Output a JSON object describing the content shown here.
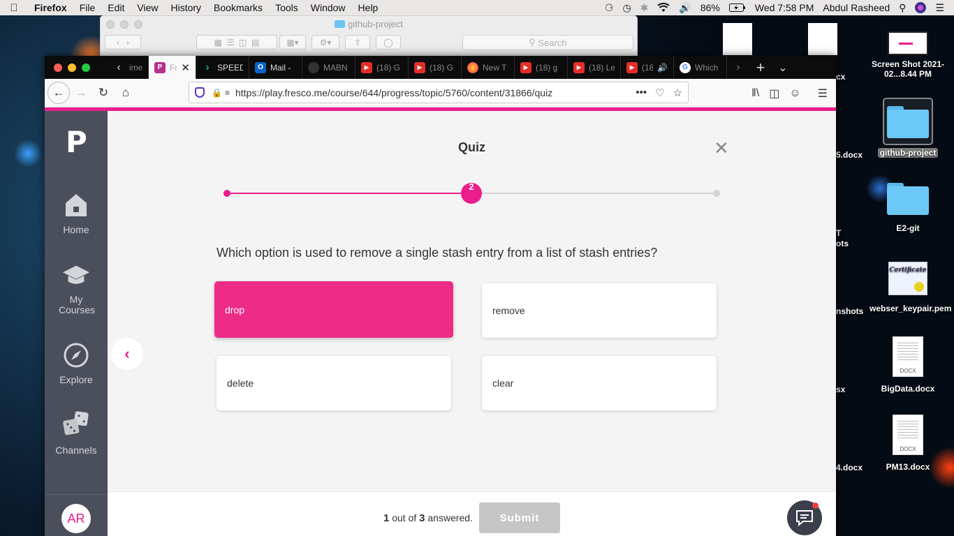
{
  "menubar": {
    "app": "Firefox",
    "items": [
      "File",
      "Edit",
      "View",
      "History",
      "Bookmarks",
      "Tools",
      "Window",
      "Help"
    ],
    "battery": "86%",
    "clock": "Wed 7:58 PM",
    "user": "Abdul Rasheed"
  },
  "finder": {
    "title": "github-project",
    "search_placeholder": "Search"
  },
  "desktop": {
    "items": [
      {
        "label": "Screen Shot 2021-02...8.44 PM",
        "icon": "screenshot-thumbnail"
      },
      {
        "label": "github-project",
        "icon": "folder-icon"
      },
      {
        "label": "E2-git",
        "icon": "folder-icon"
      },
      {
        "label": "webser_keypair.pem",
        "icon": "certificate-icon"
      },
      {
        "label": "BigData.docx",
        "icon": "docx-icon",
        "tag": "DOCX"
      },
      {
        "label": "PM13.docx",
        "icon": "docx-icon",
        "tag": "DOCX"
      }
    ],
    "partial_labels": [
      "cx",
      "5.docx",
      "T",
      "ots",
      "nshots",
      "sx",
      "4.docx"
    ]
  },
  "browser": {
    "tabs": [
      {
        "title": "ime",
        "icon": "page-icon",
        "color": "#555"
      },
      {
        "title": "Fre",
        "icon": "fresco-icon",
        "color": "#b5308c",
        "glyph": "P",
        "active": true
      },
      {
        "title": "SPEED",
        "icon": "speed-icon",
        "color": "#12a5a0",
        "glyph": "›"
      },
      {
        "title": "Mail -",
        "icon": "outlook-icon",
        "color": "#0a64c8",
        "glyph": "O"
      },
      {
        "title": "MABN",
        "icon": "github-icon",
        "color": "#333",
        "glyph": "●"
      },
      {
        "title": "(18) G",
        "icon": "youtube-icon",
        "color": "#e52d27",
        "glyph": "▶"
      },
      {
        "title": "(18) G",
        "icon": "youtube-icon",
        "color": "#e52d27",
        "glyph": "▶"
      },
      {
        "title": "New T",
        "icon": "firefox-icon",
        "color": "#ff7139",
        "glyph": "●"
      },
      {
        "title": "(18) g",
        "icon": "youtube-icon",
        "color": "#e52d27",
        "glyph": "▶"
      },
      {
        "title": "(18) Le",
        "icon": "youtube-icon",
        "color": "#e52d27",
        "glyph": "▶"
      },
      {
        "title": "(18",
        "icon": "youtube-icon",
        "color": "#e52d27",
        "glyph": "▶",
        "audio": true
      },
      {
        "title": "Which",
        "icon": "google-icon",
        "color": "#fff",
        "glyph": "G"
      }
    ],
    "url": "https://play.fresco.me/course/644/progress/topic/5760/content/31866/quiz"
  },
  "sidebar": {
    "logo": "P",
    "items": [
      {
        "label": "Home",
        "icon": "home-icon"
      },
      {
        "label": "My Courses",
        "icon": "graduation-cap-icon"
      },
      {
        "label": "Explore",
        "icon": "compass-icon"
      },
      {
        "label": "Channels",
        "icon": "dice-icon"
      }
    ],
    "avatar": "AR"
  },
  "quiz": {
    "title": "Quiz",
    "current_step": "2",
    "progress": {
      "current": 2,
      "total": 3
    },
    "question": "Which option is used to remove a single stash entry from a list of stash entries?",
    "options": [
      {
        "label": "drop",
        "selected": true
      },
      {
        "label": "remove",
        "selected": false
      },
      {
        "label": "delete",
        "selected": false
      },
      {
        "label": "clear",
        "selected": false
      }
    ],
    "answered_count": "1",
    "answered_mid": "out of",
    "total_count": "3",
    "answered_suffix": "answered.",
    "submit_label": "Submit"
  },
  "colors": {
    "accent": "#e91e8c",
    "selected_option": "#ee2b87",
    "sidebar": "#4b4f5c",
    "submit_disabled": "#c6c6c6"
  }
}
